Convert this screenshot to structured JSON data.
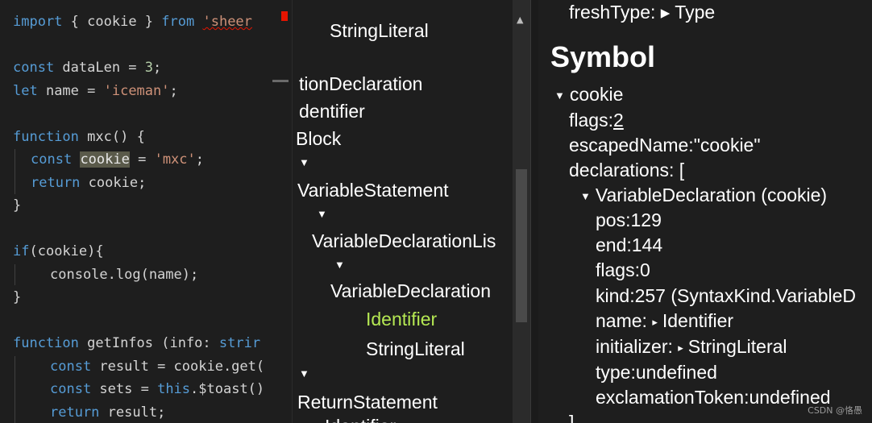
{
  "editor": {
    "line1": {
      "k1": "import",
      "p1": " { ",
      "v1": "cookie",
      "p2": " } ",
      "k2": "from",
      "p3": " ",
      "s1": "'sheer"
    },
    "line3": {
      "k1": "const",
      "p1": " dataLen = ",
      "n1": "3",
      "p2": ";"
    },
    "line4": {
      "k1": "let",
      "p1": " name = ",
      "s1": "'iceman'",
      "p2": ";"
    },
    "line6": {
      "k1": "function",
      "p1": " ",
      "f1": "mxc",
      "p2": "() {"
    },
    "line7": {
      "k1": "const",
      "p1": " ",
      "h1": "cookie",
      "p2": " = ",
      "s1": "'mxc'",
      "p3": ";"
    },
    "line8": {
      "k1": "return",
      "p1": " cookie;"
    },
    "line9": {
      "p1": "}"
    },
    "line11": {
      "k1": "if",
      "p1": "(cookie){"
    },
    "line12": {
      "p1": "console.log(name);"
    },
    "line13": {
      "p1": "}"
    },
    "line15": {
      "k1": "function",
      "p1": " getInfos (info: ",
      "k2": "strir"
    },
    "line16": {
      "k1": "const",
      "p1": " result = cookie.get("
    },
    "line17": {
      "k1": "const",
      "p1": " sets = ",
      "k2": "this",
      "p2": ".$toast()"
    },
    "line18": {
      "k1": "return",
      "p1": " result;"
    }
  },
  "tree": {
    "nodes": [
      "StringLiteral",
      "tionDeclaration",
      "dentifier",
      "Block",
      "VariableStatement",
      "VariableDeclarationLis",
      "VariableDeclaration",
      "Identifier",
      "StringLiteral",
      "ReturnStatement",
      "Identifier"
    ],
    "selected": "Identifier"
  },
  "props": {
    "top_partial": "freshType: ▸ Type",
    "heading": "Symbol",
    "symbol_name": "cookie",
    "flags_label": "flags:",
    "flags_value": "2",
    "escaped_label": "escapedName:",
    "escaped_value": "\"cookie\"",
    "declarations_label": "declarations: [",
    "decl_name": "VariableDeclaration (cookie)",
    "pos_label": "pos:",
    "pos_value": "129",
    "end_label": "end:",
    "end_value": "144",
    "dflags_label": "flags:",
    "dflags_value": "0",
    "kind_label": "kind:",
    "kind_value": "257 (SyntaxKind.VariableD",
    "name_label": "name:",
    "name_value": "Identifier",
    "init_label": "initializer:",
    "init_value": "StringLiteral",
    "type_label": "type:",
    "type_value": "undefined",
    "excl_label": "exclamationToken:",
    "excl_value": "undefined",
    "bottom_partial": "]"
  },
  "watermark": "CSDN @恪愚",
  "colors": {
    "keyword": "#569cd6",
    "string": "#ce9178",
    "selected_node": "#b5e853",
    "background": "#1e1e1e"
  }
}
